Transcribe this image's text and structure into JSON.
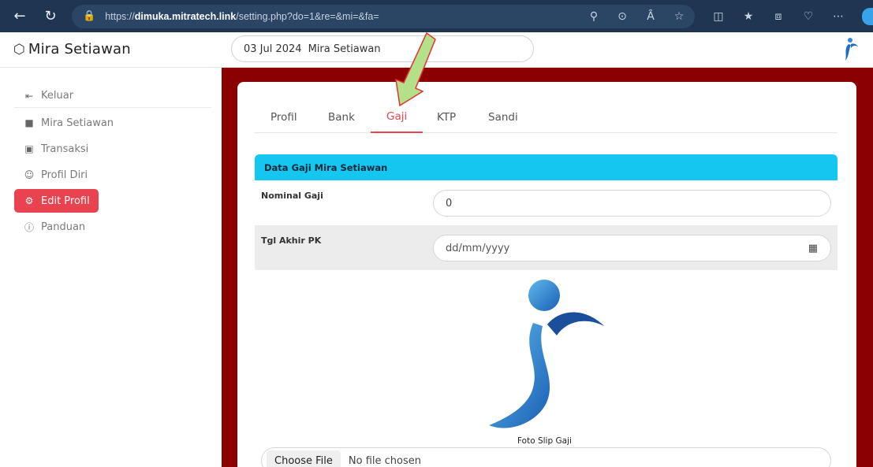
{
  "browser": {
    "url_prefix": "https://",
    "url_domain": "dimuka.mitratech.link",
    "url_path": "/setting.php?do=1&re=&mi=&fa=",
    "icons": [
      "back-icon",
      "reload-icon",
      "lock-icon",
      "key-icon",
      "zoom-icon",
      "read-aloud-icon",
      "favorite-icon",
      "split-screen-icon",
      "favorites-icon",
      "collections-icon",
      "performance-icon",
      "more-icon"
    ]
  },
  "header": {
    "brand": "Mira Setiawan",
    "date": "03 Jul 2024",
    "user": "Mira Setiawan"
  },
  "sidebar": {
    "items": [
      {
        "label": "Keluar",
        "icon": "logout-icon"
      },
      {
        "label": "Mira Setiawan",
        "icon": "user-card-icon"
      },
      {
        "label": "Transaksi",
        "icon": "window-icon"
      },
      {
        "label": "Profil Diri",
        "icon": "person-icon"
      },
      {
        "label": "Edit Profil",
        "icon": "gear-icon",
        "active": true
      },
      {
        "label": "Panduan",
        "icon": "help-icon"
      }
    ]
  },
  "tabs": [
    {
      "label": "Profil"
    },
    {
      "label": "Bank"
    },
    {
      "label": "Gaji",
      "active": true
    },
    {
      "label": "KTP"
    },
    {
      "label": "Sandi"
    }
  ],
  "form": {
    "section_title": "Data Gaji Mira Setiawan",
    "fields": [
      {
        "label": "Nominal Gaji",
        "value": "0"
      },
      {
        "label": "Tgl Akhir PK",
        "placeholder": "dd/mm/yyyy"
      }
    ],
    "image_caption": "Foto Slip Gaji",
    "file_button": "Choose File",
    "file_status": "No file chosen"
  },
  "colors": {
    "maroon": "#8b0101",
    "accent_red": "#e8434f",
    "section_cyan": "#15c6f0",
    "browser_bar": "#1f3552"
  }
}
